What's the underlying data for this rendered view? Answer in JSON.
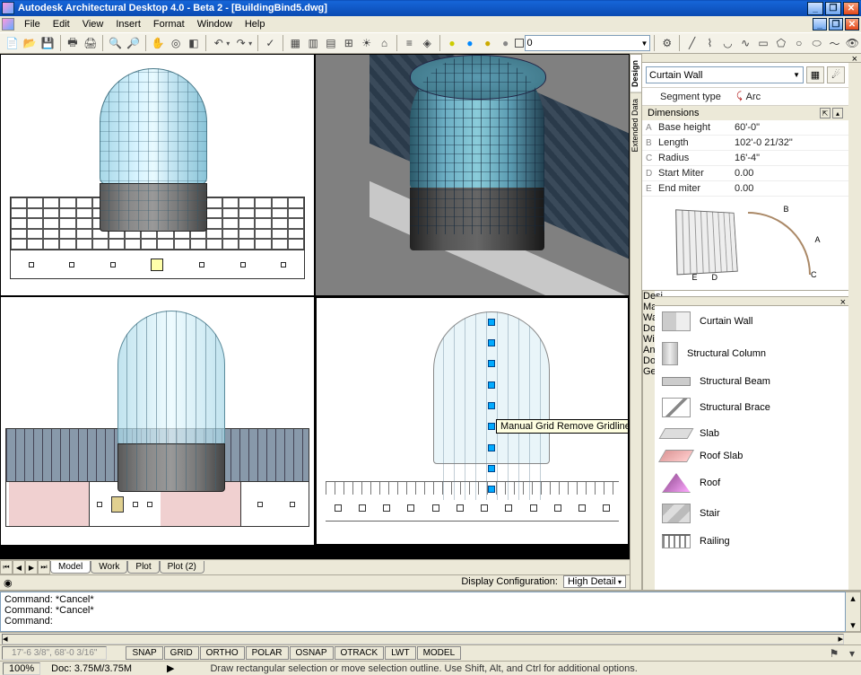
{
  "window": {
    "title": "Autodesk Architectural Desktop 4.0 - Beta 2 - [BuildingBind5.dwg]"
  },
  "menu": {
    "file": "File",
    "edit": "Edit",
    "view": "View",
    "insert": "Insert",
    "format": "Format",
    "window": "Window",
    "help": "Help"
  },
  "layer": {
    "current": "0"
  },
  "sheet_tabs": {
    "model": "Model",
    "work": "Work",
    "plot": "Plot",
    "plot2": "Plot (2)"
  },
  "design_bar": {
    "design": "Design",
    "extended": "Extended Data"
  },
  "properties": {
    "object_type": "Curtain Wall",
    "segment_row": {
      "label": "Segment type",
      "value": "Arc"
    },
    "dimensions_header": "Dimensions",
    "rows": [
      {
        "letter": "A",
        "key": "Base height",
        "val": "60'-0\""
      },
      {
        "letter": "B",
        "key": "Length",
        "val": "102'-0 21/32\""
      },
      {
        "letter": "C",
        "key": "Radius",
        "val": "16'-4\""
      },
      {
        "letter": "D",
        "key": "Start Miter",
        "val": "0.00"
      },
      {
        "letter": "E",
        "key": "End miter",
        "val": "0.00"
      }
    ],
    "diagram_labels": {
      "a": "A",
      "b": "B",
      "c": "C",
      "d": "D",
      "e": "E"
    }
  },
  "catalog_tabs": {
    "desi": "Desi...",
    "mas": "Mas...",
    "walls": "Walls",
    "doors": "Doors",
    "wind": "Wind...",
    "ann": "Ann...",
    "docu": "Docu...",
    "gen": "Gen..."
  },
  "catalog": {
    "curtain_wall": "Curtain Wall",
    "structural_column": "Structural Column",
    "structural_beam": "Structural Beam",
    "structural_brace": "Structural Brace",
    "slab": "Slab",
    "roof_slab": "Roof Slab",
    "roof": "Roof",
    "stair": "Stair",
    "railing": "Railing"
  },
  "tooltip": {
    "grid_remove": "Manual Grid Remove Gridline"
  },
  "display_config": {
    "label": "Display Configuration:",
    "value": "High Detail"
  },
  "command": {
    "line1": "Command: *Cancel*",
    "line2": "Command: *Cancel*",
    "prompt": "Command:"
  },
  "status_modes": {
    "coords": "17'-6 3/8\", 68'-0 3/16\"",
    "snap": "SNAP",
    "grid": "GRID",
    "ortho": "ORTHO",
    "polar": "POLAR",
    "osnap": "OSNAP",
    "otrack": "OTRACK",
    "lwt": "LWT",
    "model": "MODEL"
  },
  "final": {
    "zoom": "100%",
    "doc": "Doc: 3.75M/3.75M",
    "hint": "Draw rectangular selection or move selection outline. Use Shift, Alt, and Ctrl for additional options."
  }
}
